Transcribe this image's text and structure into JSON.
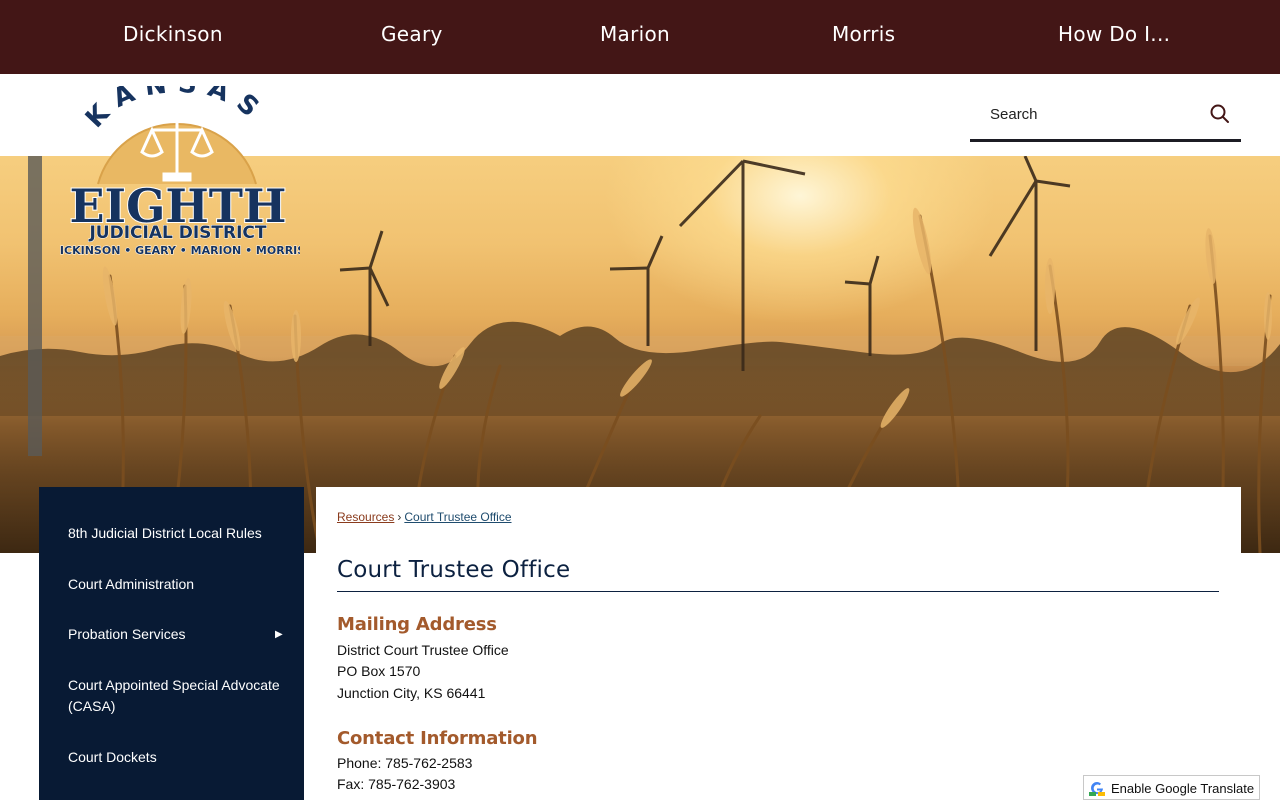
{
  "topnav": {
    "items": [
      "Dickinson",
      "Geary",
      "Marion",
      "Morris",
      "How Do I..."
    ]
  },
  "logo": {
    "arc_text": "KANSAS",
    "main_text": "EIGHTH",
    "sub_text": "JUDICIAL DISTRICT",
    "counties_text": "DICKINSON • GEARY • MARION • MORRIS"
  },
  "search": {
    "placeholder": "Search"
  },
  "sidebar": {
    "items": [
      {
        "label": "8th Judicial District Local Rules"
      },
      {
        "label": "Court Administration"
      },
      {
        "label": "Probation Services",
        "has_submenu": true
      },
      {
        "label": "Court Appointed Special Advocate (CASA)"
      },
      {
        "label": "Court Dockets"
      }
    ],
    "submenu_arrow": "▶"
  },
  "breadcrumb": {
    "items": [
      "Resources",
      "Court Trustee Office"
    ],
    "separator": "›"
  },
  "page": {
    "title": "Court Trustee Office",
    "mailing": {
      "heading": "Mailing Address",
      "lines": [
        "District Court Trustee Office",
        "PO Box 1570",
        "Junction City, KS 66441"
      ]
    },
    "contact": {
      "heading": "Contact Information",
      "lines": [
        "Phone: 785-762-2583",
        "Fax: 785-762-3903"
      ]
    }
  },
  "translate": {
    "label": "Enable Google Translate"
  },
  "colors": {
    "topnav_bg": "#431616",
    "sidebar_bg": "#081a34",
    "heading_accent": "#a35a2c",
    "title_navy": "#0c2140"
  }
}
